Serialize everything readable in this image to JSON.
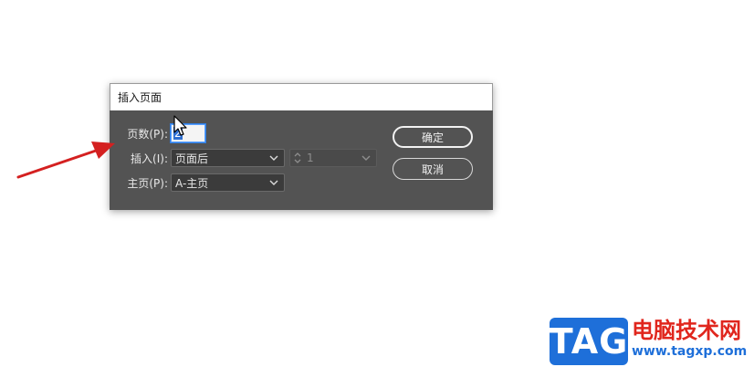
{
  "dialog": {
    "title": "插入页面",
    "pages_label": "页数(P):",
    "pages_value": "2",
    "insert_label": "插入(I):",
    "insert_selected": "页面后",
    "insert_page_value": "1",
    "master_label": "主页(P):",
    "master_selected": "A-主页",
    "ok_label": "确定",
    "cancel_label": "取消"
  },
  "watermark": {
    "logo_text": "TAG",
    "site_name": "电脑技术网",
    "site_url": "www.tagxp.com"
  },
  "colors": {
    "dialog_body": "#535353",
    "arrow": "#d42020",
    "focus_ring": "#2f7de1",
    "logo_blue": "#1e6fd9",
    "brand_red": "#e0261d"
  }
}
